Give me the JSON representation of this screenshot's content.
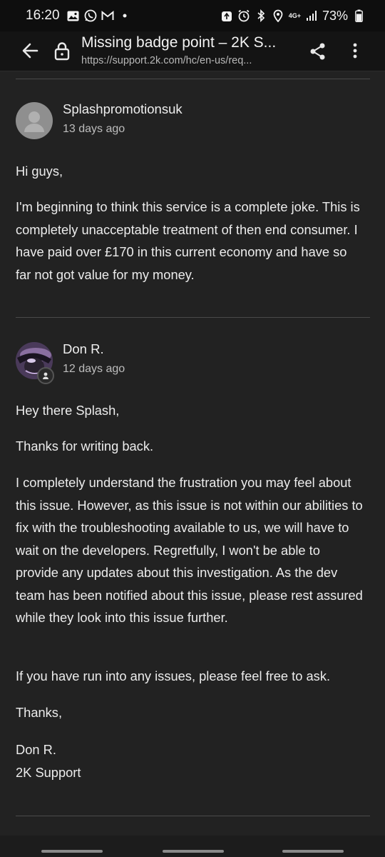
{
  "status_bar": {
    "time": "16:20",
    "network_label_top": "4G+",
    "battery": "73%"
  },
  "browser": {
    "title": "Missing badge point – 2K S...",
    "url": "https://support.2k.com/hc/en-us/req..."
  },
  "comments": [
    {
      "author": "Splashpromotionsuk",
      "time": "13 days ago",
      "paragraphs": [
        "Hi guys,",
        "I'm beginning to think this service is a complete joke. This is completely unacceptable treatment of then end consumer. I have paid over £170 in this current economy and have so far not got value for my money."
      ]
    },
    {
      "author": "Don R.",
      "time": "12 days ago",
      "paragraphs": [
        "Hey there Splash,",
        "Thanks for writing back.",
        "I completely understand the frustration you may feel about this issue. However, as this issue is not within our abilities to fix with the troubleshooting available to us, we will have to wait on the developers. Regretfully, I won't be able to provide any updates about this investigation. As the dev team has been notified about this issue, please rest assured while they look into this issue further.",
        "If you have run into any issues, please feel free to ask.",
        "Thanks,",
        "Don R.",
        "2K Support"
      ]
    }
  ]
}
